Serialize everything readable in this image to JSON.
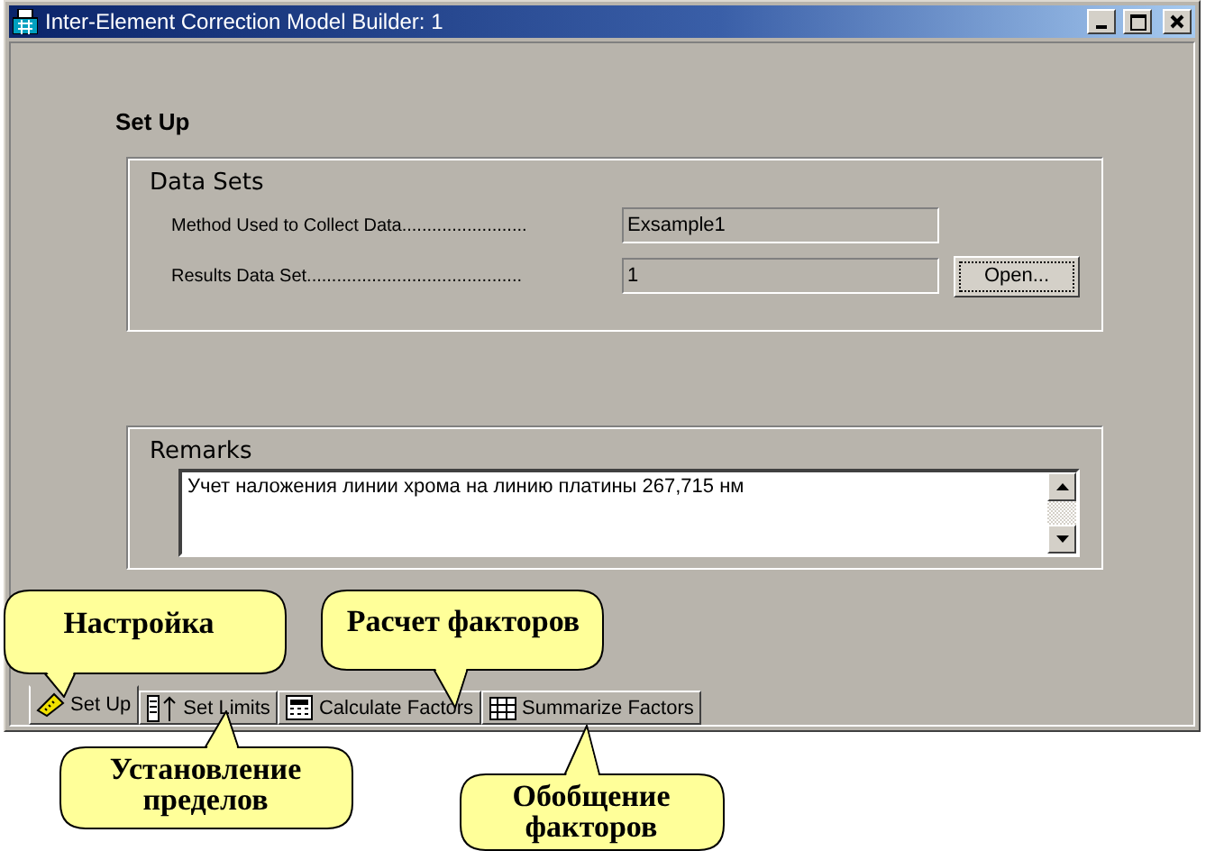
{
  "window": {
    "title": "Inter-Element Correction Model Builder: 1"
  },
  "setup": {
    "heading": "Set Up",
    "data_sets": {
      "title": "Data Sets",
      "rows": [
        {
          "label": "Method Used to Collect Data.........................",
          "value": "Exsample1"
        },
        {
          "label": "Results Data Set...........................................",
          "value": "1",
          "button": "Open..."
        }
      ]
    },
    "remarks": {
      "title": "Remarks",
      "value": "Учет наложения линии хрома на линию платины 267,715 нм"
    }
  },
  "tabs": [
    {
      "label": "Set Up",
      "selected": true,
      "kind": "setup"
    },
    {
      "label": "Set Limits",
      "selected": false,
      "kind": "limits"
    },
    {
      "label": "Calculate Factors",
      "selected": false,
      "kind": "calc"
    },
    {
      "label": "Summarize Factors",
      "selected": false,
      "kind": "summary"
    }
  ],
  "callouts": [
    {
      "text": "Настройка",
      "kind": "down"
    },
    {
      "text": "Расчет факторов",
      "kind": "down"
    },
    {
      "text": "Установление пределов",
      "kind": "up"
    },
    {
      "text": "Обобщение факторов",
      "kind": "up"
    }
  ]
}
